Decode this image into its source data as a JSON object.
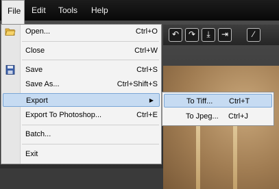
{
  "menubar": {
    "items": [
      {
        "label": "File"
      },
      {
        "label": "Edit"
      },
      {
        "label": "Tools"
      },
      {
        "label": "Help"
      }
    ]
  },
  "file_menu": {
    "items": [
      {
        "label": "Open...",
        "shortcut": "Ctrl+O",
        "icon": "folder-open-icon"
      },
      {
        "label": "Close",
        "shortcut": "Ctrl+W"
      },
      {
        "label": "Save",
        "shortcut": "Ctrl+S",
        "icon": "floppy-disk-icon"
      },
      {
        "label": "Save As...",
        "shortcut": "Ctrl+Shift+S"
      },
      {
        "label": "Export",
        "submenu": true
      },
      {
        "label": "Export To Photoshop...",
        "shortcut": "Ctrl+E"
      },
      {
        "label": "Batch..."
      },
      {
        "label": "Exit"
      }
    ]
  },
  "export_submenu": {
    "items": [
      {
        "label": "To Tiff...",
        "shortcut": "Ctrl+T"
      },
      {
        "label": "To Jpeg...",
        "shortcut": "Ctrl+J"
      }
    ]
  },
  "toolbar": {
    "icons": [
      "rotate-left-icon",
      "rotate-right-icon",
      "flip-vertical-icon",
      "flip-horizontal-icon",
      "eyedropper-icon"
    ]
  },
  "colors": {
    "menubar_bg": "#111111",
    "menu_bg": "#f3f3f3",
    "highlight": "#c6dbf2",
    "highlight_border": "#7aa6d6"
  }
}
